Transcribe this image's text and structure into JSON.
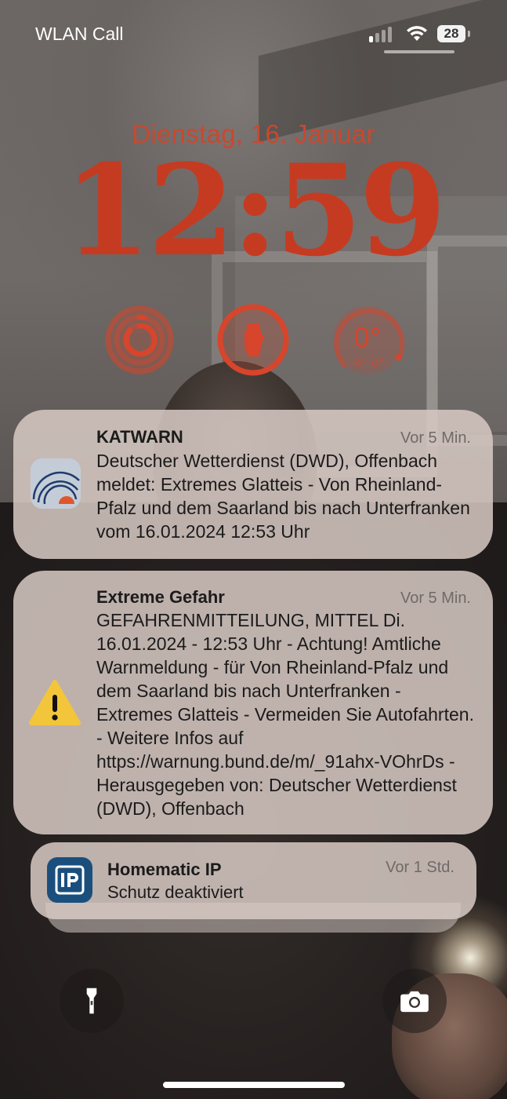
{
  "status_bar": {
    "carrier": "WLAN Call",
    "battery": "28"
  },
  "lock_screen": {
    "date": "Dienstag, 16. Januar",
    "time": "12:59"
  },
  "widgets": {
    "weather": {
      "temp": "0°",
      "range": "-4° 0°"
    }
  },
  "notifications": [
    {
      "app_icon": "katwarn-icon",
      "title": "KATWARN",
      "time": "Vor 5 Min.",
      "body": "Deutscher Wetterdienst (DWD), Offen­bach meldet: Extremes Glatteis - Von Rheinland-Pfalz und dem Saarland bis nach Unterfranken vom 16.01.2024 12:53 Uhr"
    },
    {
      "app_icon": "warning-icon",
      "title": "Extreme Gefahr",
      "time": "Vor 5 Min.",
      "body": "GEFAHRENMITTEILUNG, MITTEL Di. 16.01.2024 - 12:53 Uhr - Achtung! Amtli­che Warnmeldung - für Von Rheinland-Pfalz und dem Saarland bis nach Unter­franken - Extremes Glatteis - Vermeiden Sie Autofahrten. - Weitere Infos auf https://warnung.bund.de/m/_91ahx-VOhrDs - Herausgegeben von: Deutscher Wetterdienst (DWD), Offenbach"
    },
    {
      "app_icon": "homematic-ip-icon",
      "title": "Homematic IP",
      "time": "Vor 1 Std.",
      "body": "Schutz deaktiviert"
    }
  ],
  "colors": {
    "accent": "#c53b22",
    "notification_bg": "#d7cac4"
  }
}
